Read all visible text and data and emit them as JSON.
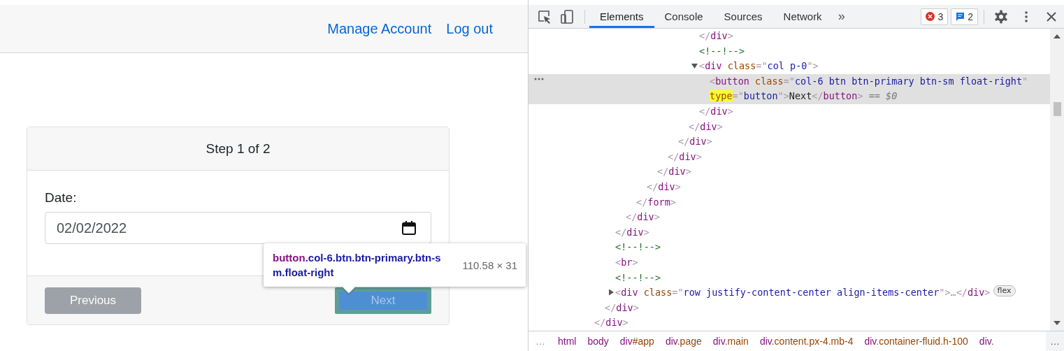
{
  "page": {
    "nav_links": [
      "Manage Account",
      "Log out"
    ],
    "card": {
      "header": "Step 1 of 2",
      "date_label": "Date:",
      "date_value": "02/02/2022",
      "buttons": [
        {
          "label": "Previous",
          "kind": "secondary",
          "disabled": true,
          "highlighted": false
        },
        {
          "label": "Next",
          "kind": "primary",
          "disabled": false,
          "highlighted": true
        }
      ]
    }
  },
  "tooltip": {
    "tag": "button",
    "classes": ".col-6.btn.btn-primary.btn-sm.float-right",
    "size": "110.58 × 31"
  },
  "devtools": {
    "tabs": [
      {
        "label": "Elements",
        "selected": true
      },
      {
        "label": "Console",
        "selected": false
      },
      {
        "label": "Sources",
        "selected": false
      },
      {
        "label": "Network",
        "selected": false
      }
    ],
    "overflow": "»",
    "error_count": "3",
    "message_count": "2",
    "tree": {
      "selected": false,
      "close": [
        {
          "kind": "punct",
          "text": "</"
        },
        {
          "kind": "tag",
          "text": "div"
        },
        {
          "kind": "punct",
          "text": ">"
        }
      ],
      "children": [
        {
          "selected": false,
          "close": [
            {
              "kind": "punct",
              "text": "</"
            },
            {
              "kind": "tag",
              "text": "div"
            },
            {
              "kind": "punct",
              "text": ">"
            }
          ],
          "children": [
            {
              "selected": false,
              "close": [
                {
                  "kind": "punct",
                  "text": "</"
                },
                {
                  "kind": "tag",
                  "text": "div"
                },
                {
                  "kind": "punct",
                  "text": ">"
                }
              ],
              "children": [
                {
                  "selected": false,
                  "close": [
                    {
                      "kind": "punct",
                      "text": "</"
                    },
                    {
                      "kind": "tag",
                      "text": "div"
                    },
                    {
                      "kind": "punct",
                      "text": ">"
                    }
                  ],
                  "children": [
                    {
                      "selected": false,
                      "close": [
                        {
                          "kind": "punct",
                          "text": "</"
                        },
                        {
                          "kind": "tag",
                          "text": "form"
                        },
                        {
                          "kind": "punct",
                          "text": ">"
                        }
                      ],
                      "children": [
                        {
                          "selected": false,
                          "close": [
                            {
                              "kind": "punct",
                              "text": "</"
                            },
                            {
                              "kind": "tag",
                              "text": "div"
                            },
                            {
                              "kind": "punct",
                              "text": ">"
                            }
                          ],
                          "children": [
                            {
                              "selected": false,
                              "close": [
                                {
                                  "kind": "punct",
                                  "text": "</"
                                },
                                {
                                  "kind": "tag",
                                  "text": "div"
                                },
                                {
                                  "kind": "punct",
                                  "text": ">"
                                }
                              ],
                              "children": [
                                {
                                  "selected": false,
                                  "close": [
                                    {
                                      "kind": "punct",
                                      "text": "</"
                                    },
                                    {
                                      "kind": "tag",
                                      "text": "div"
                                    },
                                    {
                                      "kind": "punct",
                                      "text": ">"
                                    }
                                  ],
                                  "children": [
                                    {
                                      "selected": false,
                                      "close": [
                                        {
                                          "kind": "punct",
                                          "text": "</"
                                        },
                                        {
                                          "kind": "tag",
                                          "text": "div"
                                        },
                                        {
                                          "kind": "punct",
                                          "text": ">"
                                        }
                                      ],
                                      "children": [
                                        {
                                          "selected": false,
                                          "close": [
                                            {
                                              "kind": "punct",
                                              "text": "</"
                                            },
                                            {
                                              "kind": "tag",
                                              "text": "div"
                                            },
                                            {
                                              "kind": "punct",
                                              "text": ">"
                                            }
                                          ],
                                          "children": [
                                            {
                                              "selected": false,
                                              "close": [
                                                {
                                                  "kind": "punct",
                                                  "text": "</"
                                                },
                                                {
                                                  "kind": "tag",
                                                  "text": "div"
                                                },
                                                {
                                                  "kind": "punct",
                                                  "text": ">"
                                                }
                                              ]
                                            },
                                            {
                                              "selected": false,
                                              "open": [
                                                {
                                                  "kind": "comment",
                                                  "text": "<!--!-->"
                                                }
                                              ]
                                            },
                                            {
                                              "selected": false,
                                              "expanded": true,
                                              "open": [
                                                {
                                                  "kind": "punct",
                                                  "text": "<"
                                                },
                                                {
                                                  "kind": "tag",
                                                  "text": "div"
                                                },
                                                {
                                                  "kind": "attr",
                                                  "text": " class"
                                                },
                                                {
                                                  "kind": "punct",
                                                  "text": "=\""
                                                },
                                                {
                                                  "kind": "value",
                                                  "text": "col p-0"
                                                },
                                                {
                                                  "kind": "punct",
                                                  "text": "\">"
                                                }
                                              ],
                                              "close": [
                                                {
                                                  "kind": "punct",
                                                  "text": "</"
                                                },
                                                {
                                                  "kind": "tag",
                                                  "text": "div"
                                                },
                                                {
                                                  "kind": "punct",
                                                  "text": ">"
                                                }
                                              ],
                                              "children": [
                                                {
                                                  "selected": true,
                                                  "hint": "== $0",
                                                  "open": [
                                                    {
                                                      "kind": "punct",
                                                      "text": "<"
                                                    },
                                                    {
                                                      "kind": "tag",
                                                      "text": "button"
                                                    },
                                                    {
                                                      "kind": "attr",
                                                      "text": " class"
                                                    },
                                                    {
                                                      "kind": "punct",
                                                      "text": "=\""
                                                    },
                                                    {
                                                      "kind": "value",
                                                      "text": "col-6 btn btn-primary btn-sm float-right"
                                                    },
                                                    {
                                                      "kind": "punct",
                                                      "text": "\" "
                                                    },
                                                    {
                                                      "kind": "match",
                                                      "text": "type"
                                                    },
                                                    {
                                                      "kind": "punct",
                                                      "text": "=\""
                                                    },
                                                    {
                                                      "kind": "value",
                                                      "text": "button"
                                                    },
                                                    {
                                                      "kind": "punct",
                                                      "text": "\">"
                                                    },
                                                    {
                                                      "kind": "text",
                                                      "text": "Next"
                                                    },
                                                    {
                                                      "kind": "punct",
                                                      "text": "</"
                                                    },
                                                    {
                                                      "kind": "tag",
                                                      "text": "button"
                                                    },
                                                    {
                                                      "kind": "punct",
                                                      "text": ">"
                                                    }
                                                  ]
                                                }
                                              ]
                                            }
                                          ]
                                        }
                                      ]
                                    }
                                  ]
                                }
                              ]
                            }
                          ]
                        }
                      ]
                    }
                  ]
                }
              ]
            },
            {
              "selected": false,
              "open": [
                {
                  "kind": "comment",
                  "text": "<!--!-->"
                }
              ]
            },
            {
              "selected": false,
              "open": [
                {
                  "kind": "punct",
                  "text": "<"
                },
                {
                  "kind": "tag",
                  "text": "br"
                },
                {
                  "kind": "punct",
                  "text": ">"
                }
              ]
            },
            {
              "selected": false,
              "open": [
                {
                  "kind": "comment",
                  "text": "<!--!-->"
                }
              ]
            },
            {
              "selected": false,
              "expanded": false,
              "badge": "flex",
              "open": [
                {
                  "kind": "punct",
                  "text": "<"
                },
                {
                  "kind": "tag",
                  "text": "div"
                },
                {
                  "kind": "attr",
                  "text": " class"
                },
                {
                  "kind": "punct",
                  "text": "=\""
                },
                {
                  "kind": "value",
                  "text": "row justify-content-center align-items-center"
                },
                {
                  "kind": "punct",
                  "text": "\">…</"
                },
                {
                  "kind": "tag",
                  "text": "div"
                },
                {
                  "kind": "punct",
                  "text": ">"
                }
              ]
            }
          ]
        }
      ]
    },
    "breadcrumbs": [
      {
        "tag": "html"
      },
      {
        "tag": "body"
      },
      {
        "tag": "div",
        "suffix": "#app"
      },
      {
        "tag": "div",
        "suffix": ".page"
      },
      {
        "tag": "div",
        "suffix": ".main"
      },
      {
        "tag": "div",
        "suffix": ".content.px-4.mb-4"
      },
      {
        "tag": "div",
        "suffix": ".container-fluid.h-100"
      },
      {
        "tag": "div",
        "suffix": "."
      }
    ],
    "breadcrumb_more_left": "…",
    "breadcrumb_more_right": "…"
  }
}
